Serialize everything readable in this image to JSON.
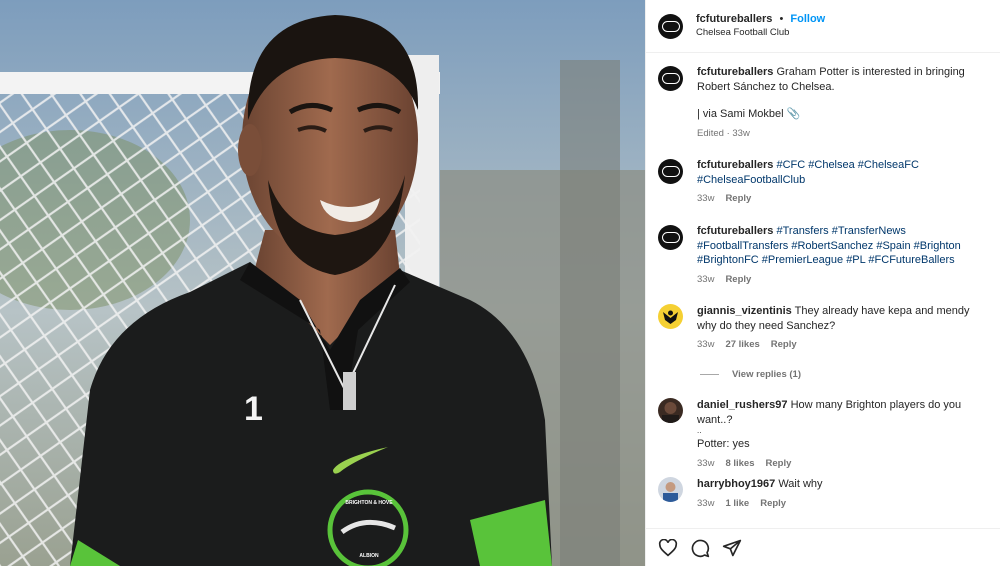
{
  "post": {
    "username": "fcfutureballers",
    "separator": "•",
    "follow_label": "Follow",
    "location": "Chelsea Football Club",
    "caption_author": "fcfutureballers",
    "caption_text": "Graham Potter is interested in bringing Robert Sánchez to Chelsea.",
    "caption_credit": "| via Sami Mokbel 📎",
    "caption_meta": "Edited · 33w"
  },
  "comments": [
    {
      "user": "fcfutureballers",
      "text_tags": "#CFC #Chelsea #ChelseaFC #ChelseaFootballClub",
      "time": "33w",
      "reply": "Reply"
    },
    {
      "user": "fcfutureballers",
      "text_tags": "#Transfers #TransferNews #FootballTransfers #RobertSanchez #Spain #Brighton #BrightonFC #PremierLeague #PL #FCFutureBallers",
      "time": "33w",
      "reply": "Reply"
    },
    {
      "user": "giannis_vizentinis",
      "text": "They already have kepa and mendy why do they need Sanchez?",
      "time": "33w",
      "likes": "27 likes",
      "reply": "Reply",
      "view_replies": "View replies (1)"
    },
    {
      "user": "daniel_rushers97",
      "text": "How many Brighton players do you want..?",
      "text2": "..",
      "text3": "Potter: yes",
      "time": "33w",
      "likes": "8 likes",
      "reply": "Reply"
    },
    {
      "user": "harrybhoy1967",
      "text": "Wait why",
      "time": "33w",
      "likes": "1 like",
      "reply": "Reply"
    }
  ],
  "photo": {
    "shirt_number": "1",
    "badge_top": "BRIGHTON & HOVE",
    "badge_bottom": "ALBION"
  },
  "icons": {
    "like": "heart-icon",
    "comment": "comment-icon",
    "share": "share-icon"
  }
}
